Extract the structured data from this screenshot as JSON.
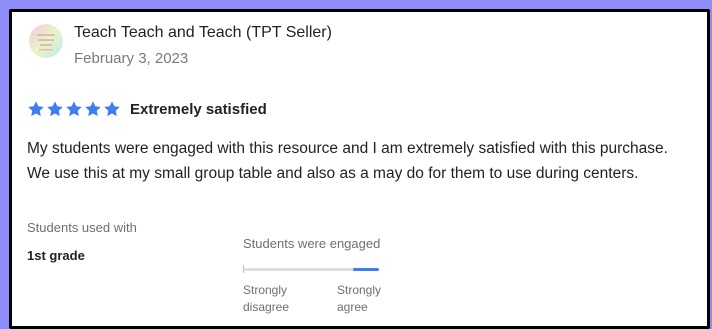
{
  "review": {
    "reviewer_name": "Teach Teach and Teach (TPT Seller)",
    "date": "February 3, 2023",
    "rating": 5,
    "rating_max": 5,
    "rating_title": "Extremely satisfied",
    "star_color": "#3d7ef0",
    "body_lines": [
      "My students were engaged with this resource and I am extremely satisfied with this purchase.",
      "We use this at my small group table and also as a may do for them to use during centers."
    ],
    "students_used_with_label": "Students used with",
    "students_used_with_value": "1st grade",
    "engagement": {
      "label": "Students were engaged",
      "low_label": "Strongly disagree",
      "high_label": "Strongly agree",
      "level": 1.0,
      "fill_color": "#3d7ef0"
    }
  },
  "colors": {
    "background": "#8e8df7",
    "card": "#ffffff",
    "border": "#000000"
  },
  "icons": {
    "avatar": "seller-avatar-icon",
    "star": "star-icon"
  }
}
